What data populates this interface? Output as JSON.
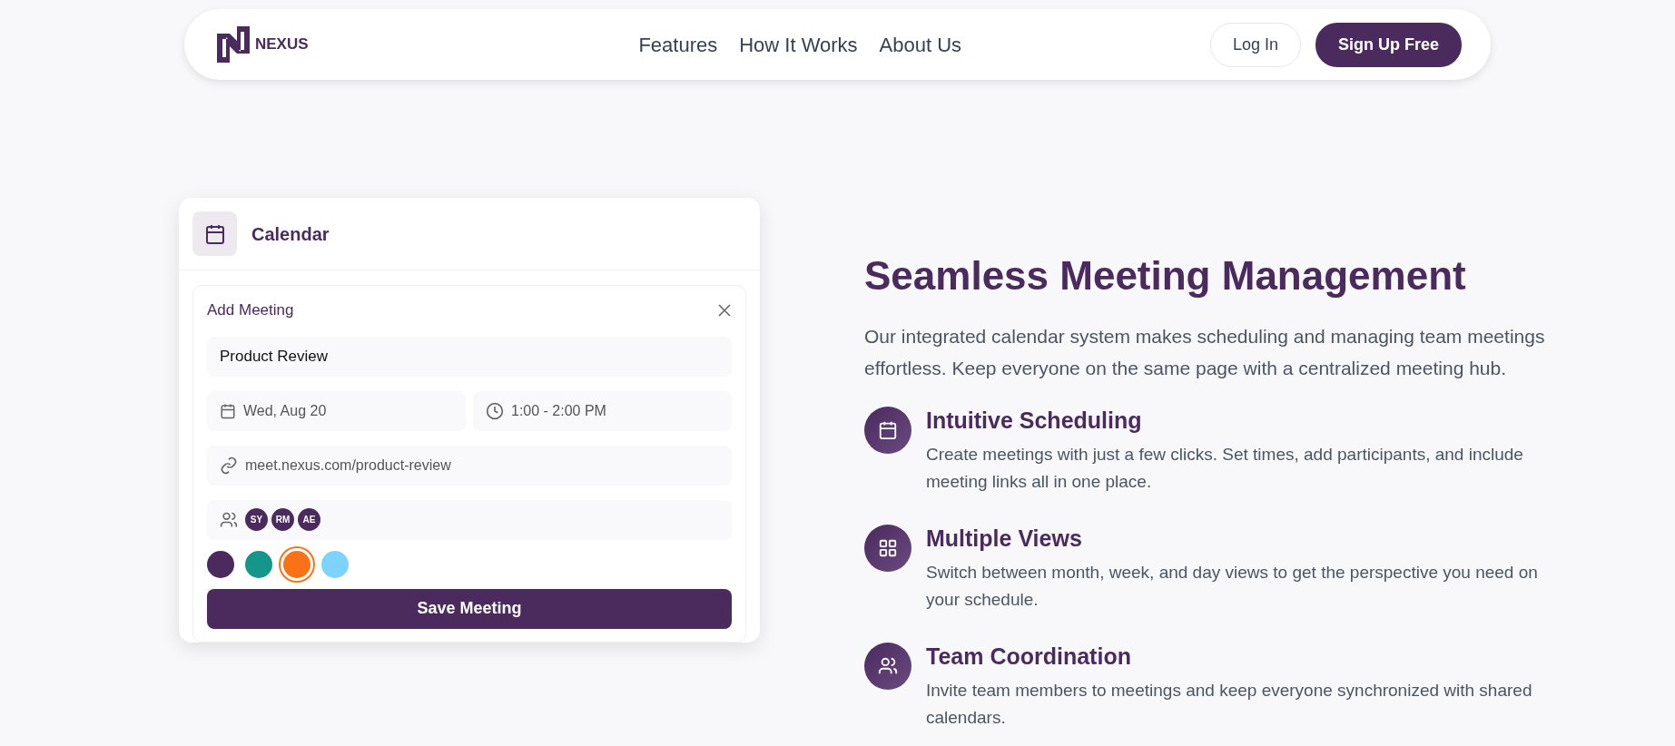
{
  "navbar": {
    "logo_text": "NEXUS",
    "links": [
      {
        "label": "Features"
      },
      {
        "label": "How It Works"
      },
      {
        "label": "About Us"
      }
    ],
    "login": "Log In",
    "signup": "Sign Up Free"
  },
  "calendar_card": {
    "title": "Calendar",
    "form": {
      "title": "Add Meeting",
      "meeting_title": "Product Review",
      "date": "Wed, Aug 20",
      "time": "1:00 - 2:00 PM",
      "link": "meet.nexus.com/product-review",
      "participants": [
        {
          "initials": "SY"
        },
        {
          "initials": "RM"
        },
        {
          "initials": "AE"
        }
      ],
      "colors": [
        {
          "color": "#4b2a5e",
          "selected": false
        },
        {
          "color": "#14978a",
          "selected": false
        },
        {
          "color": "#f97316",
          "selected": true
        },
        {
          "color": "#7dd3fc",
          "selected": false
        }
      ],
      "save_button": "Save Meeting"
    }
  },
  "section": {
    "heading": "Seamless Meeting Management",
    "intro": "Our integrated calendar system makes scheduling and managing team meetings effortless. Keep everyone on the same page with a centralized meeting hub.",
    "features": [
      {
        "kind": "calendar",
        "title": "Intuitive Scheduling",
        "text": "Create meetings with just a few clicks. Set times, add participants, and include meeting links all in one place."
      },
      {
        "kind": "grid",
        "title": "Multiple Views",
        "text": "Switch between month, week, and day views to get the perspective you need on your schedule."
      },
      {
        "kind": "users",
        "title": "Team Coordination",
        "text": "Invite team members to meetings and keep everyone synchronized with shared calendars."
      }
    ]
  }
}
